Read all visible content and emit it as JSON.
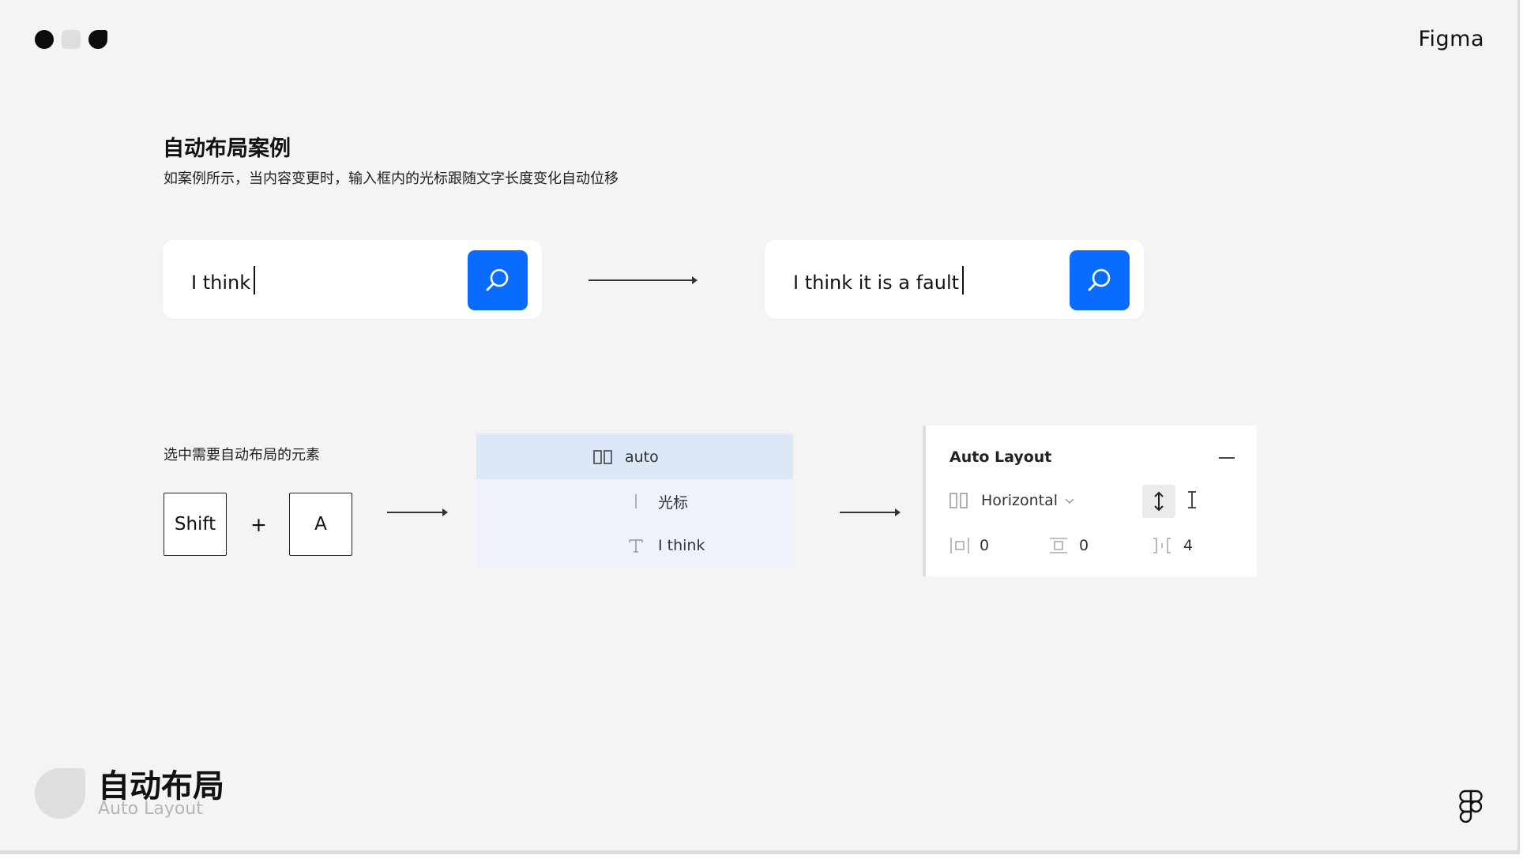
{
  "brand": "Figma",
  "section": {
    "title": "自动布局案例",
    "subtitle": "如案例所示，当内容变更时，输入框内的光标跟随文字长度变化自动位移"
  },
  "search_before": {
    "value": "I think"
  },
  "search_after": {
    "value": "I think it is a fault"
  },
  "instruction": "选中需要自动布局的元素",
  "keys": {
    "first": "Shift",
    "plus": "+",
    "second": "A"
  },
  "layers": [
    {
      "label": "auto",
      "icon": "frame-icon",
      "selected": true
    },
    {
      "label": "光标",
      "icon": "line-icon",
      "selected": false
    },
    {
      "label": "I think",
      "icon": "text-icon",
      "selected": false
    }
  ],
  "auto_layout_panel": {
    "title": "Auto Layout",
    "direction": "Horizontal",
    "padding_horizontal": "0",
    "padding_vertical": "0",
    "spacing": "4"
  },
  "footer": {
    "title": "自动布局",
    "subtitle": "Auto Layout"
  },
  "colors": {
    "accent": "#0a6cff",
    "background": "#f4f4f4",
    "selection": "#dce8f7"
  }
}
